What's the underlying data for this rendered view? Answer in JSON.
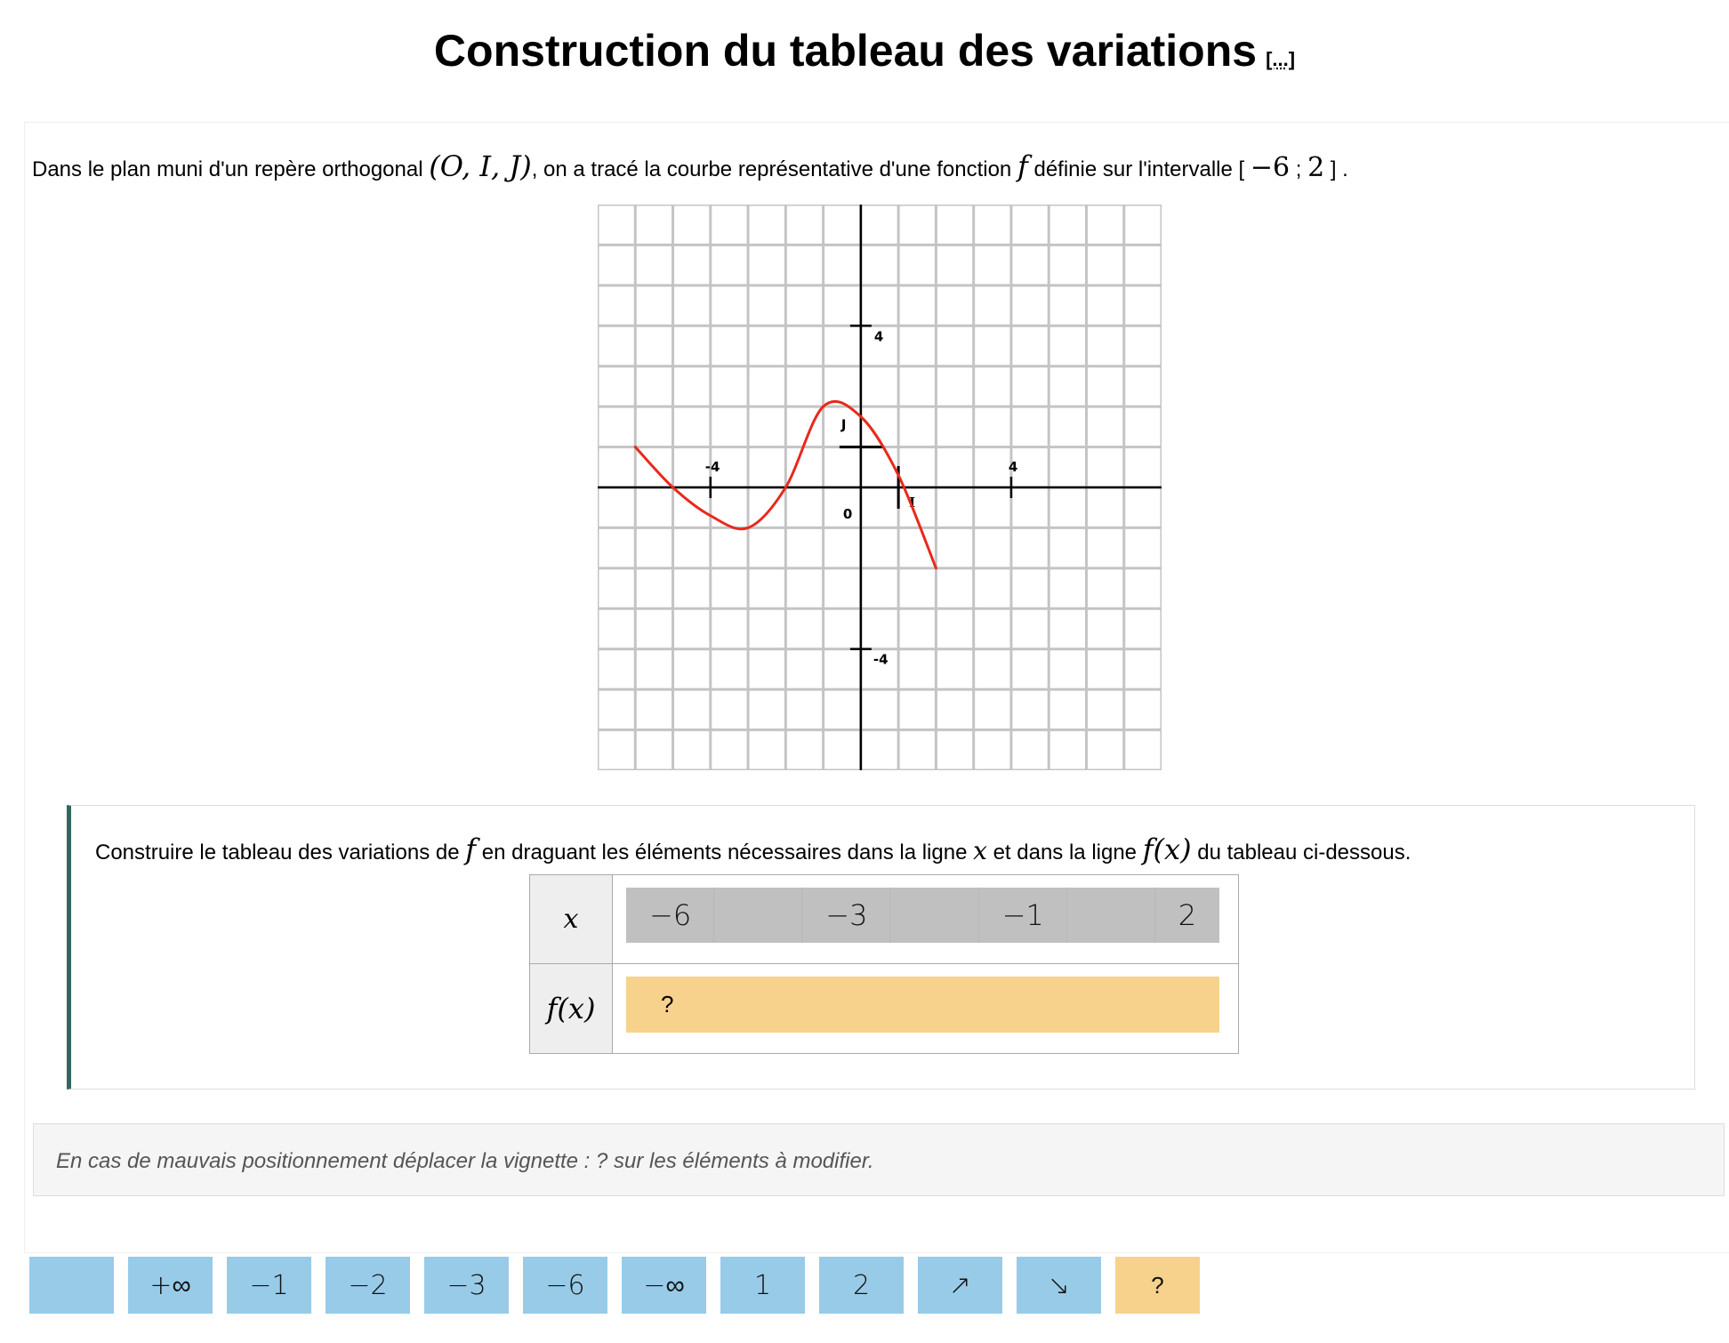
{
  "page": {
    "title": "Construction du tableau des variations",
    "more_link": "[...]"
  },
  "statement": {
    "part1": "Dans le plan muni d'un repère orthogonal ",
    "frame": "(O, I, J)",
    "part2": ", on a tracé la courbe représentative d'une fonction ",
    "f": "f",
    "part3": " définie sur l'intervalle [ ",
    "lower": "−6",
    "sep": " ; ",
    "upper": "2",
    "part4": " ] ."
  },
  "graph": {
    "x_range": [
      -7,
      8
    ],
    "y_range": [
      -7,
      7
    ],
    "labels": {
      "origin": "0",
      "x_tick": "4",
      "x_tick_neg": "-4",
      "y_tick": "4",
      "y_tick_neg": "-4",
      "I": "I",
      "J": "J"
    },
    "curve_color": "#e8291c",
    "curve_points": [
      [
        -6,
        1
      ],
      [
        -5,
        0
      ],
      [
        -4,
        -0.7
      ],
      [
        -3,
        -1
      ],
      [
        -2,
        0
      ],
      [
        -1,
        2
      ],
      [
        0,
        1.75
      ],
      [
        1,
        0.3
      ],
      [
        2,
        -2
      ]
    ]
  },
  "instruction": {
    "part1": "Construire le tableau des variations de ",
    "f": "f",
    "part2": " en draguant les éléments nécessaires dans la ligne ",
    "x": "x",
    "part3": " et dans la ligne ",
    "fx": "f(x)",
    "part4": " du tableau ci-dessous."
  },
  "table": {
    "x_header": "x",
    "fx_header": "f(x)",
    "x_values": [
      "−6",
      "",
      "−3",
      "",
      "−1",
      "",
      "2"
    ],
    "fx_placeholder": "?"
  },
  "info": {
    "text": "En cas de mauvais positionnement déplacer la vignette : ? sur les éléments à modifier."
  },
  "tiles": [
    {
      "label": "",
      "kind": "blank"
    },
    {
      "label": "+∞",
      "kind": "value"
    },
    {
      "label": "−1",
      "kind": "value"
    },
    {
      "label": "−2",
      "kind": "value"
    },
    {
      "label": "−3",
      "kind": "value"
    },
    {
      "label": "−6",
      "kind": "value"
    },
    {
      "label": "−∞",
      "kind": "value"
    },
    {
      "label": "1",
      "kind": "value"
    },
    {
      "label": "2",
      "kind": "value"
    },
    {
      "label": "↗",
      "kind": "arrow-up"
    },
    {
      "label": "↘",
      "kind": "arrow-down"
    },
    {
      "label": "?",
      "kind": "placeholder"
    }
  ],
  "colors": {
    "tile_blue": "#98cbe8",
    "tile_orange": "#f7d28d",
    "x_row_gray": "#c0c0c0",
    "accent_teal": "#33665f"
  }
}
